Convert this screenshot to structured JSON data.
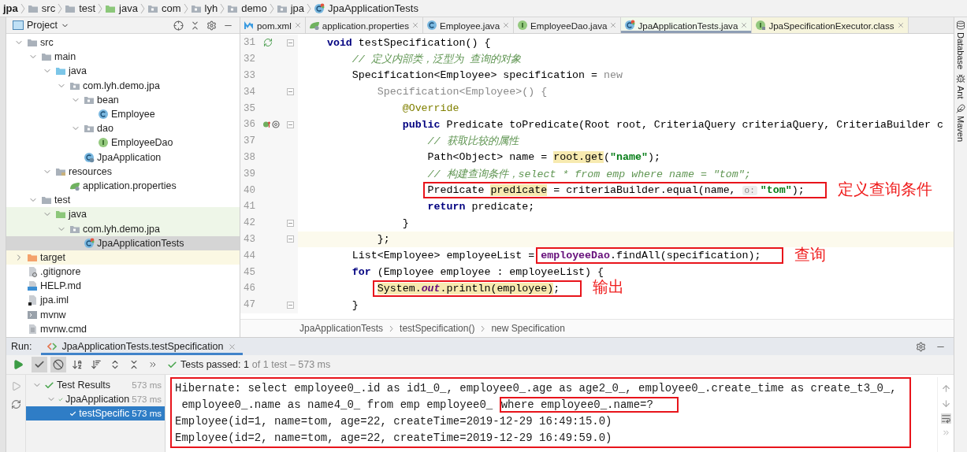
{
  "breadcrumbs": [
    {
      "label": "jpa",
      "kind": "module"
    },
    {
      "label": "src",
      "kind": "folder"
    },
    {
      "label": "test",
      "kind": "folder"
    },
    {
      "label": "java",
      "kind": "test-root"
    },
    {
      "label": "com",
      "kind": "package"
    },
    {
      "label": "lyh",
      "kind": "package"
    },
    {
      "label": "demo",
      "kind": "package"
    },
    {
      "label": "jpa",
      "kind": "package"
    },
    {
      "label": "JpaApplicationTests",
      "kind": "test-class"
    }
  ],
  "project_panel": {
    "title": "Project",
    "tree": [
      {
        "label": "src",
        "kind": "folder",
        "expanded": true,
        "selected": false,
        "children": [
          {
            "label": "main",
            "kind": "folder",
            "expanded": true,
            "selected": false,
            "children": [
              {
                "label": "java",
                "kind": "source-root",
                "expanded": true,
                "selected": false,
                "children": [
                  {
                    "label": "com.lyh.demo.jpa",
                    "kind": "package",
                    "expanded": true,
                    "selected": false,
                    "children": [
                      {
                        "label": "bean",
                        "kind": "package",
                        "expanded": true,
                        "selected": false,
                        "children": [
                          {
                            "label": "Employee",
                            "kind": "class",
                            "selected": false
                          }
                        ]
                      },
                      {
                        "label": "dao",
                        "kind": "package",
                        "expanded": true,
                        "selected": false,
                        "children": [
                          {
                            "label": "EmployeeDao",
                            "kind": "interface",
                            "selected": false
                          }
                        ]
                      },
                      {
                        "label": "JpaApplication",
                        "kind": "app-class",
                        "selected": false
                      }
                    ]
                  }
                ]
              },
              {
                "label": "resources",
                "kind": "resources",
                "expanded": true,
                "selected": false,
                "children": [
                  {
                    "label": "application.properties",
                    "kind": "properties",
                    "selected": false
                  }
                ]
              }
            ]
          },
          {
            "label": "test",
            "kind": "folder",
            "expanded": true,
            "selected": false,
            "children": [
              {
                "label": "java",
                "kind": "test-root",
                "expanded": true,
                "selected": false,
                "color": "#eef6e8",
                "children": [
                  {
                    "label": "com.lyh.demo.jpa",
                    "kind": "package",
                    "expanded": true,
                    "selected": false,
                    "color": "#eef6e8",
                    "children": [
                      {
                        "label": "JpaApplicationTests",
                        "kind": "test-class",
                        "selected": true
                      }
                    ]
                  }
                ]
              }
            ]
          }
        ]
      },
      {
        "label": "target",
        "kind": "excluded",
        "expanded": false,
        "selected": false,
        "color": "#fbf8e3"
      },
      {
        "label": ".gitignore",
        "kind": "gitignore",
        "selected": false
      },
      {
        "label": "HELP.md",
        "kind": "markdown",
        "selected": false
      },
      {
        "label": "jpa.iml",
        "kind": "iml",
        "selected": false
      },
      {
        "label": "mvnw",
        "kind": "script",
        "selected": false
      },
      {
        "label": "mvnw.cmd",
        "kind": "file",
        "selected": false
      }
    ]
  },
  "tabs": [
    {
      "label": "pom.xml",
      "kind": "maven",
      "selected": false
    },
    {
      "label": "application.properties",
      "kind": "properties",
      "selected": false
    },
    {
      "label": "Employee.java",
      "kind": "class",
      "selected": false
    },
    {
      "label": "EmployeeDao.java",
      "kind": "interface",
      "selected": false
    },
    {
      "label": "JpaApplicationTests.java",
      "kind": "test-class",
      "selected": true,
      "color": "#f1f8ec"
    },
    {
      "label": "JpaSpecificationExecutor.class",
      "kind": "library-interface",
      "selected": false,
      "color": "#f6f4dc"
    }
  ],
  "editor": {
    "lines": [
      {
        "number": "31",
        "gutter_icons": [
          {
            "kind": "run"
          }
        ],
        "fold": true,
        "current": false,
        "tokens": [
          {
            "text": "    void",
            "kind": "keyword"
          },
          {
            "text": " testSpecification() {",
            "kind": "plain"
          }
        ]
      },
      {
        "number": "32",
        "fold": false,
        "current": false,
        "tokens": [
          {
            "text": "        // 定义内部类，泛型为 查询的对象",
            "kind": "comment"
          }
        ]
      },
      {
        "number": "33",
        "fold": false,
        "current": false,
        "tokens": [
          {
            "text": "        Specification<Employee> specification = ",
            "kind": "plain"
          },
          {
            "text": "new",
            "kind": "muted"
          }
        ]
      },
      {
        "number": "34",
        "fold": true,
        "current": false,
        "tokens": [
          {
            "text": "            Specification<Employee>() {",
            "kind": "muted"
          }
        ]
      },
      {
        "number": "35",
        "fold": false,
        "current": false,
        "tokens": [
          {
            "text": "                @Override",
            "kind": "annotation"
          }
        ]
      },
      {
        "number": "36",
        "gutter_icons": [
          {
            "kind": "implements"
          },
          {
            "kind": "overrides"
          }
        ],
        "fold": true,
        "current": false,
        "tokens": [
          {
            "text": "                public",
            "kind": "keyword"
          },
          {
            "text": " Predicate toPredicate(Root root, CriteriaQuery criteriaQuery, CriteriaBuilder c",
            "kind": "plain"
          }
        ]
      },
      {
        "number": "37",
        "fold": false,
        "current": false,
        "tokens": [
          {
            "text": "                    // 获取比较的属性",
            "kind": "comment"
          }
        ]
      },
      {
        "number": "38",
        "fold": false,
        "current": false,
        "tokens": [
          {
            "text": "                    Path<Object> name = ",
            "kind": "plain"
          },
          {
            "text": "root.get",
            "kind": "plain",
            "highlighted": true
          },
          {
            "text": "(",
            "kind": "plain"
          },
          {
            "text": "\"name\"",
            "kind": "string"
          },
          {
            "text": ");",
            "kind": "plain"
          }
        ]
      },
      {
        "number": "39",
        "fold": false,
        "current": false,
        "tokens": [
          {
            "text": "                    // 构建查询条件，select * from emp where name = \"tom\";",
            "kind": "comment"
          }
        ]
      },
      {
        "number": "40",
        "fold": false,
        "current": false,
        "annotation": {
          "note": "定义查询条件",
          "tokens": [
            {
              "text": "                    Predicate ",
              "kind": "plain"
            },
            {
              "text": "predicate",
              "kind": "plain",
              "highlighted": true
            },
            {
              "text": " = criteriaBuilder.equal(name, ",
              "kind": "plain"
            },
            {
              "text": "o:",
              "kind": "hint"
            },
            {
              "text": "\"tom\"",
              "kind": "string"
            },
            {
              "text": ");",
              "kind": "plain"
            }
          ]
        }
      },
      {
        "number": "41",
        "fold": false,
        "current": false,
        "tokens": [
          {
            "text": "                    return",
            "kind": "keyword"
          },
          {
            "text": " predicate;",
            "kind": "plain"
          }
        ]
      },
      {
        "number": "42",
        "fold": true,
        "current": false,
        "tokens": [
          {
            "text": "                }",
            "kind": "plain"
          }
        ]
      },
      {
        "number": "43",
        "fold": true,
        "current": true,
        "tokens": [
          {
            "text": "            };",
            "kind": "plain"
          }
        ]
      },
      {
        "number": "44",
        "fold": false,
        "current": false,
        "tokens": [
          {
            "text": "        List<Employee> employeeList = ",
            "kind": "plain"
          }
        ],
        "annotation": {
          "note": "查询",
          "tokens": [
            {
              "text": "employeeDao",
              "kind": "field"
            },
            {
              "text": ".findAll(specification);",
              "kind": "plain"
            }
          ]
        }
      },
      {
        "number": "45",
        "fold": false,
        "current": false,
        "tokens": [
          {
            "text": "        for",
            "kind": "keyword"
          },
          {
            "text": " (Employee employee : employeeList) {",
            "kind": "plain"
          }
        ]
      },
      {
        "number": "46",
        "fold": false,
        "current": false,
        "annotation": {
          "note": "输出",
          "tokens": [
            {
              "text": "            System.",
              "kind": "plain",
              "highlighted": true
            },
            {
              "text": "out",
              "kind": "static",
              "highlighted": true
            },
            {
              "text": ".println(employee)",
              "kind": "plain",
              "highlighted": true
            },
            {
              "text": ";",
              "kind": "plain"
            }
          ]
        }
      },
      {
        "number": "47",
        "fold": true,
        "current": false,
        "tokens": [
          {
            "text": "        }",
            "kind": "plain"
          }
        ]
      }
    ],
    "breadcrumbs": [
      "JpaApplicationTests",
      "testSpecification()",
      "new Specification"
    ]
  },
  "side_tools": [
    {
      "label": "Database",
      "kind": "database"
    },
    {
      "label": "Ant",
      "kind": "ant"
    },
    {
      "label": "Maven",
      "kind": "maven"
    }
  ],
  "run_panel": {
    "label": "Run:",
    "tab": {
      "label": "JpaApplicationTests.testSpecification",
      "selected": true
    },
    "toolbar": [
      {
        "kind": "show-passed",
        "on": true
      },
      {
        "kind": "show-ignored",
        "on": true
      },
      {
        "kind": "sort-alpha",
        "on": false
      },
      {
        "kind": "sort-duration",
        "on": false
      },
      {
        "kind": "expand-all"
      },
      {
        "kind": "collapse-all"
      },
      {
        "kind": "more"
      }
    ],
    "status": {
      "main": "Tests passed: 1",
      "detail": "of 1 test – 573 ms"
    },
    "tests": [
      {
        "label": "Test Results",
        "time": "573 ms",
        "expanded": true,
        "selected": false,
        "children": [
          {
            "label": "JpaApplication",
            "time": "573 ms",
            "expanded": true,
            "selected": false,
            "children": [
              {
                "label": "testSpecific",
                "time": "573 ms",
                "selected": true
              }
            ]
          }
        ]
      }
    ],
    "console": [
      {
        "text": "Hibernate: select employee0_.id as id1_0_, employee0_.age as age2_0_, employee0_.create_time as create_t3_0_,"
      },
      {
        "text": " employee0_.name as name4_0_ from emp employee0_ ",
        "annotation": "where employee0_.name=?"
      },
      {
        "text": "Employee(id=1, name=tom, age=22, createTime=2019-12-29 16:49:15.0)"
      },
      {
        "text": "Employee(id=2, name=tom, age=22, createTime=2019-12-29 16:49:59.0)"
      }
    ]
  }
}
